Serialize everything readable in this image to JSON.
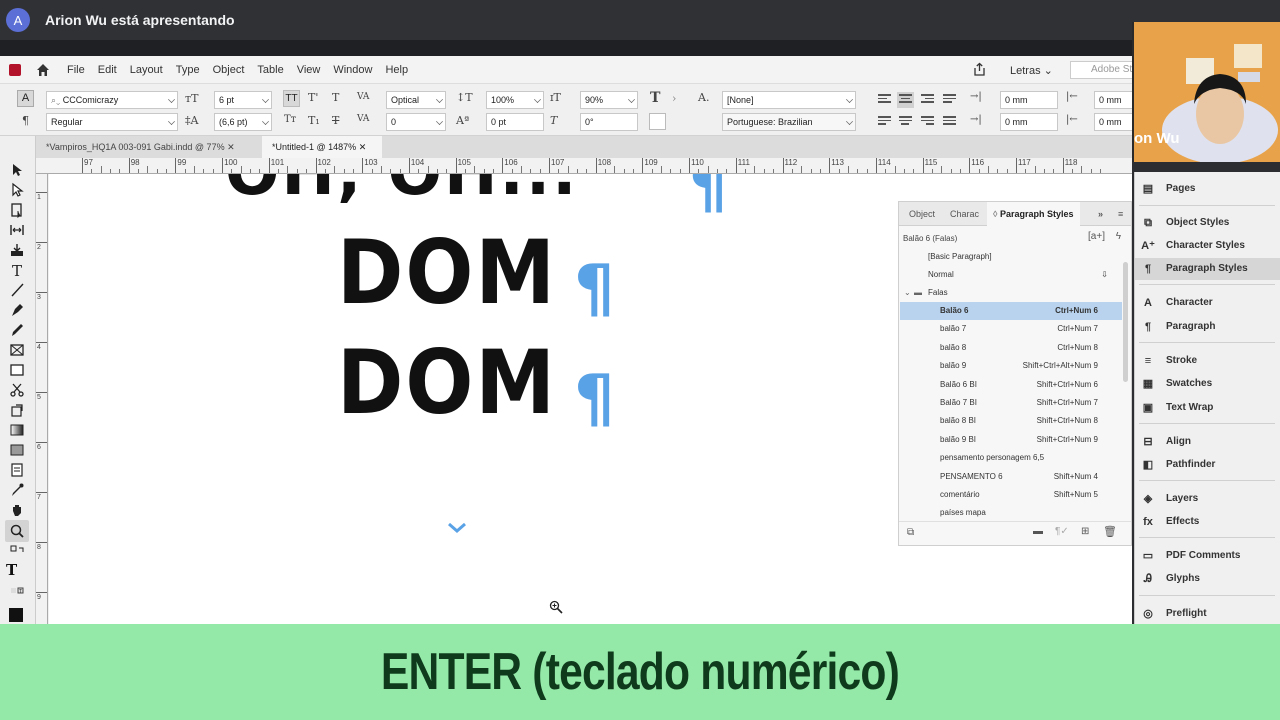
{
  "meet": {
    "avatar_letter": "A",
    "presenting_text": "Arion Wu está apresentando"
  },
  "menubar": {
    "items": [
      "File",
      "Edit",
      "Layout",
      "Type",
      "Object",
      "Table",
      "View",
      "Window",
      "Help"
    ],
    "workspace": "Letras",
    "search_placeholder": "Adobe Sto"
  },
  "control_panel": {
    "font_family": "CCComicrazy",
    "font_style": "Regular",
    "font_size": "6 pt",
    "leading": "(6,6 pt)",
    "kerning": "Optical",
    "tracking": "0",
    "vertical_scale": "100%",
    "horizontal_scale": "90%",
    "baseline_shift": "0 pt",
    "skew": "0°",
    "char_style": "[None]",
    "language": "Portuguese: Brazilian",
    "indent_left": "0 mm",
    "indent_right": "0 mm",
    "indent_first": "0 mm",
    "indent_last": "0 mm"
  },
  "doc_tabs": [
    {
      "label": "*Vampiros_HQ1A 003-091 Gabi.indd @ 77%"
    },
    {
      "label": "*Untitled-1 @ 1487%"
    }
  ],
  "ruler_marks": [
    "97",
    "98",
    "99",
    "100",
    "101",
    "102",
    "103",
    "104",
    "105",
    "106",
    "107",
    "108",
    "109",
    "110",
    "111",
    "112",
    "113",
    "114",
    "115",
    "116",
    "117",
    "118"
  ],
  "vruler_marks": [
    "1",
    "2",
    "3",
    "4",
    "5",
    "6",
    "7",
    "8",
    "9"
  ],
  "canvas": {
    "line1": "OH, OH...",
    "line2": "DOM",
    "line3": "DOM",
    "pilcrow": "¶"
  },
  "paragraph_styles_panel": {
    "tabs": [
      "Object",
      "Charac",
      "Paragraph Styles"
    ],
    "current_style": "Balão 6 (Falas)",
    "basic": "[Basic Paragraph]",
    "normal": "Normal",
    "group": "Falas",
    "styles": [
      {
        "name": "Balão 6",
        "shortcut": "Ctrl+Num 6",
        "selected": true
      },
      {
        "name": "balão 7",
        "shortcut": "Ctrl+Num 7"
      },
      {
        "name": "balão 8",
        "shortcut": "Ctrl+Num 8"
      },
      {
        "name": "balão 9",
        "shortcut": "Shift+Ctrl+Alt+Num 9"
      },
      {
        "name": "Balão 6 BI",
        "shortcut": "Shift+Ctrl+Num 6"
      },
      {
        "name": "Balão 7 BI",
        "shortcut": "Shift+Ctrl+Num 7"
      },
      {
        "name": "balão 8 BI",
        "shortcut": "Shift+Ctrl+Num 8"
      },
      {
        "name": "balão 9 BI",
        "shortcut": "Shift+Ctrl+Num 9"
      },
      {
        "name": "pensamento personagem 6,5",
        "shortcut": ""
      },
      {
        "name": "PENSAMENTO 6",
        "shortcut": "Shift+Num 4"
      },
      {
        "name": "comentário",
        "shortcut": "Shift+Num 5"
      },
      {
        "name": "países mapa",
        "shortcut": ""
      }
    ]
  },
  "dock": {
    "items": [
      "Pages",
      "Object Styles",
      "Character Styles",
      "Paragraph Styles",
      "Character",
      "Paragraph",
      "Stroke",
      "Swatches",
      "Text Wrap",
      "Align",
      "Pathfinder",
      "Layers",
      "Effects",
      "PDF Comments",
      "Glyphs",
      "Preflight"
    ],
    "active": "Paragraph Styles"
  },
  "webcam": {
    "name_label": "on Wu"
  },
  "caption": "ENTER (teclado numérico)",
  "colors": {
    "caption_bg": "#94e9a9",
    "caption_text": "#0f3b1c",
    "selection": "#b9d3ee",
    "pilcrow": "#5aa2e6",
    "app_logo": "#b3122b"
  }
}
